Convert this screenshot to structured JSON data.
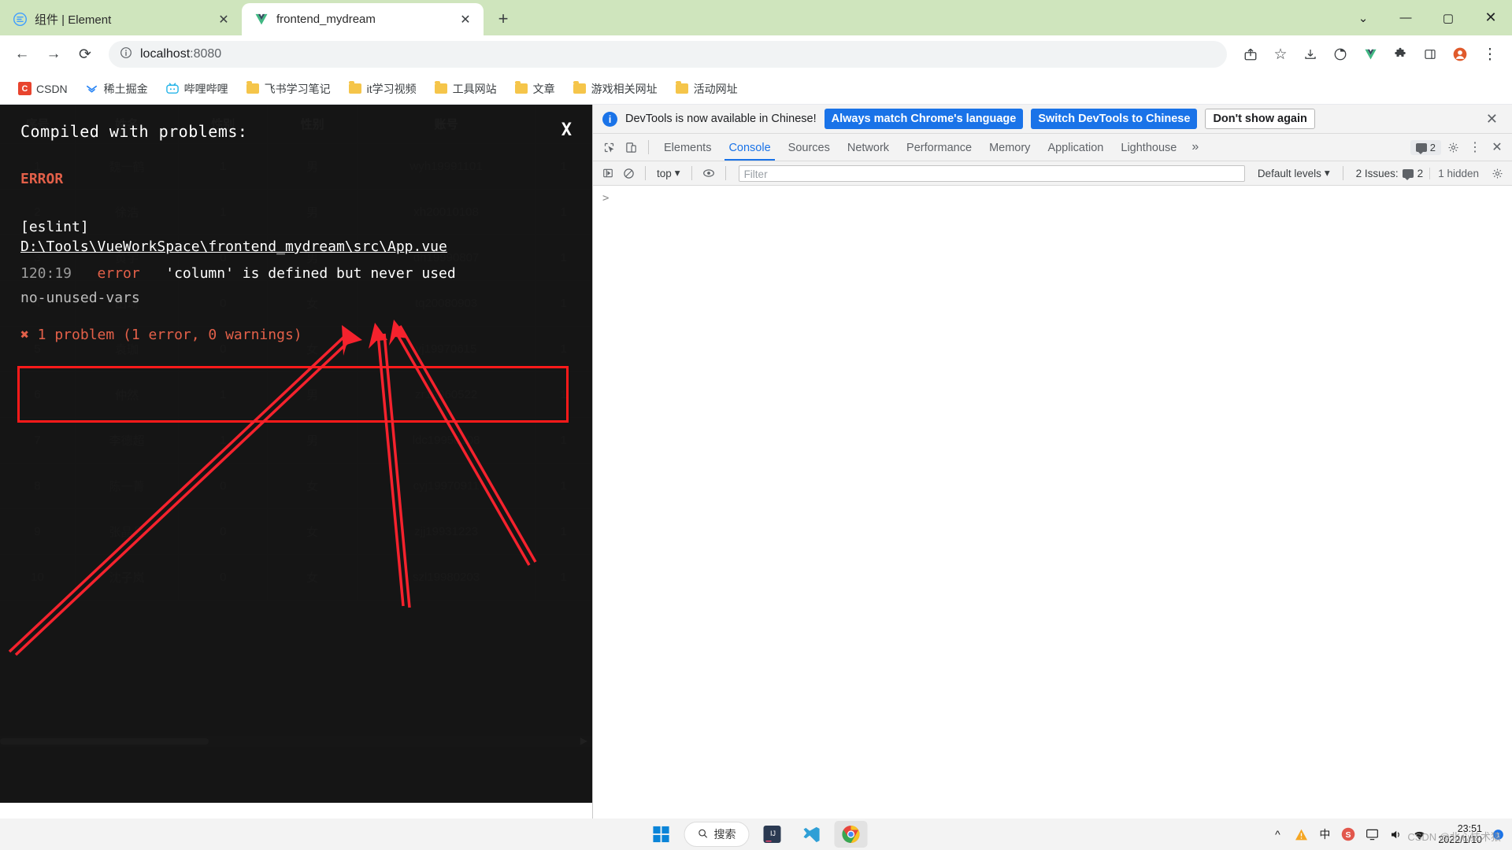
{
  "browser": {
    "tabs": [
      {
        "title": "组件 | Element",
        "icon": "element-logo-icon",
        "active": false
      },
      {
        "title": "frontend_mydream",
        "icon": "vue-logo-icon",
        "active": true
      }
    ],
    "new_tab_label": "+",
    "window_controls": {
      "minimize": "—",
      "maximize": "▢",
      "close": "✕",
      "more": "⌄"
    },
    "toolbar": {
      "back": "←",
      "forward": "→",
      "reload": "⟳",
      "site_info_icon": "info-circle-icon",
      "url_host": "localhost",
      "url_port": ":8080",
      "share": "⬆",
      "bookmark_star": "☆",
      "extension_puzzle": "🧩",
      "split_view": "▯",
      "profile": "●",
      "menu": "⋮"
    },
    "bookmarks": [
      {
        "label": "CSDN",
        "icon": "csdn-icon"
      },
      {
        "label": "稀土掘金",
        "icon": "juejin-icon"
      },
      {
        "label": "哔哩哔哩",
        "icon": "bilibili-icon"
      },
      {
        "label": "飞书学习笔记",
        "icon": "folder-icon"
      },
      {
        "label": "it学习视频",
        "icon": "folder-icon"
      },
      {
        "label": "工具网站",
        "icon": "folder-icon"
      },
      {
        "label": "文章",
        "icon": "folder-icon"
      },
      {
        "label": "游戏相关网址",
        "icon": "folder-icon"
      },
      {
        "label": "活动网址",
        "icon": "folder-icon"
      }
    ]
  },
  "error_overlay": {
    "title": "Compiled with problems:",
    "close_label": "X",
    "error_label": "ERROR",
    "plugin": "[eslint]",
    "file_path": "D:\\Tools\\VueWorkSpace\\frontend_mydream\\src\\App.vue",
    "location": "120:19",
    "severity": "error",
    "message": "'column' is defined but never used",
    "rule": "no-unused-vars",
    "summary": "✖ 1 problem (1 error, 0 warnings)"
  },
  "table": {
    "columns": [
      "序号",
      "姓名",
      "性别",
      "性别",
      "账号",
      ""
    ],
    "rows": [
      [
        "1",
        "魏一鹤",
        "1",
        "男",
        "wyh19991101",
        "1"
      ],
      [
        "2",
        "徐浩",
        "1",
        "男",
        "xh20010108",
        "1"
      ],
      [
        "3",
        "黄宇",
        "0",
        "男",
        "dh19990807",
        "1"
      ],
      [
        "4",
        "田琦",
        "0",
        "女",
        "tq20080903",
        "1"
      ],
      [
        "5",
        "袁珈",
        "0",
        "女",
        "yj19970615",
        "1"
      ],
      [
        "6",
        "仲然",
        "1",
        "男",
        "zr19960522",
        "1"
      ],
      [
        "7",
        "李德超",
        "1",
        "男",
        "ldc19950108",
        "1"
      ],
      [
        "8",
        "陈一菁",
        "0",
        "女",
        "cyj19970911",
        "1"
      ],
      [
        "9",
        "张晶晶",
        "0",
        "女",
        "zjj19931223",
        "1"
      ],
      [
        "10",
        "沈子岚",
        "0",
        "女",
        "szl19980203",
        "1"
      ]
    ]
  },
  "devtools": {
    "banner": {
      "message": "DevTools is now available in Chinese!",
      "primary_button": "Always match Chrome's language",
      "secondary_button": "Switch DevTools to Chinese",
      "dismiss_button": "Don't show again",
      "close_icon": "close-icon"
    },
    "tabs": [
      {
        "label": "Elements",
        "active": false
      },
      {
        "label": "Console",
        "active": true
      },
      {
        "label": "Sources",
        "active": false
      },
      {
        "label": "Network",
        "active": false
      },
      {
        "label": "Performance",
        "active": false
      },
      {
        "label": "Memory",
        "active": false
      },
      {
        "label": "Application",
        "active": false
      },
      {
        "label": "Lighthouse",
        "active": false
      }
    ],
    "more_tabs": "»",
    "message_count": "2",
    "settings_icon": "gear-icon",
    "more_icon": "kebab-menu-icon",
    "close_icon": "close-icon",
    "console_toolbar": {
      "sidebar_icon": "console-sidebar-icon",
      "clear_icon": "clear-console-icon",
      "context": "top",
      "eye_icon": "live-expression-icon",
      "filter_placeholder": "Filter",
      "filter_value": "",
      "levels": "Default levels",
      "issues_label": "2 Issues:",
      "issues_count": "2",
      "hidden_label": "1 hidden",
      "settings_icon": "gear-icon"
    },
    "prompt_symbol": ">"
  },
  "taskbar": {
    "start_label": "start-icon",
    "search_placeholder": "搜索",
    "apps": [
      {
        "name": "intellij-idea-icon"
      },
      {
        "name": "vscode-icon"
      },
      {
        "name": "chrome-icon",
        "active": true
      }
    ],
    "tray": {
      "chevron": "^",
      "warning_icon": "warning-icon",
      "ime": "中",
      "sogou_icon": "sogou-icon",
      "monitor_icon": "display-icon",
      "volume_icon": "volume-icon",
      "network_icon": "network-icon",
      "time": "23:51",
      "date": "2022/1/10",
      "notification_count": "1"
    }
  },
  "watermark": "CSDN @北心技术猿"
}
